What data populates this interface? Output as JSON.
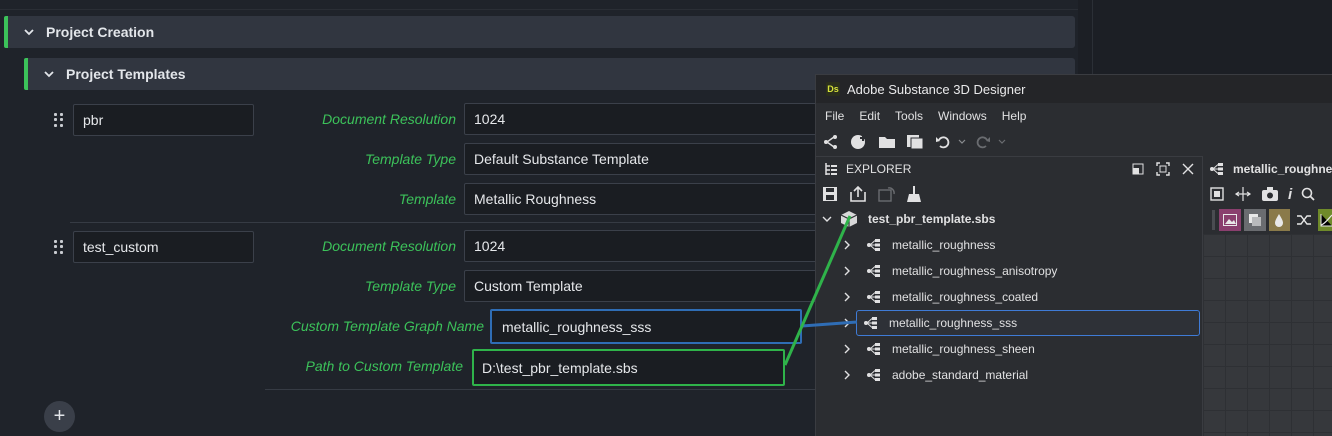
{
  "sections": {
    "project_creation": "Project Creation",
    "project_templates": "Project Templates"
  },
  "templates": [
    {
      "name": "pbr",
      "document_resolution_label": "Document Resolution",
      "document_resolution": "1024",
      "template_type_label": "Template Type",
      "template_type": "Default Substance Template",
      "template_label": "Template",
      "template": "Metallic Roughness"
    },
    {
      "name": "test_custom",
      "document_resolution_label": "Document Resolution",
      "document_resolution": "1024",
      "template_type_label": "Template Type",
      "template_type": "Custom Template",
      "graph_name_label": "Custom Template Graph Name",
      "graph_name": "metallic_roughness_sss",
      "path_label": "Path to Custom Template",
      "path": "D:\\test_pbr_template.sbs"
    }
  ],
  "add_button": "+",
  "designer": {
    "app_title": "Adobe Substance 3D Designer",
    "logo": "Ds",
    "menu": [
      "File",
      "Edit",
      "Tools",
      "Windows",
      "Help"
    ],
    "explorer_title": "EXPLORER",
    "package": "test_pbr_template.sbs",
    "graphs": [
      "metallic_roughness",
      "metallic_roughness_anisotropy",
      "metallic_roughness_coated",
      "metallic_roughness_sss",
      "metallic_roughness_sheen",
      "adobe_standard_material"
    ],
    "selected_graph_index": 3,
    "graph_tab": "metallic_roughnes"
  },
  "colors": {
    "accent_green": "#3cc25a",
    "highlight_blue": "#2f6db5",
    "highlight_green": "#2fb34a",
    "selection_blue": "#3f7bd6"
  }
}
